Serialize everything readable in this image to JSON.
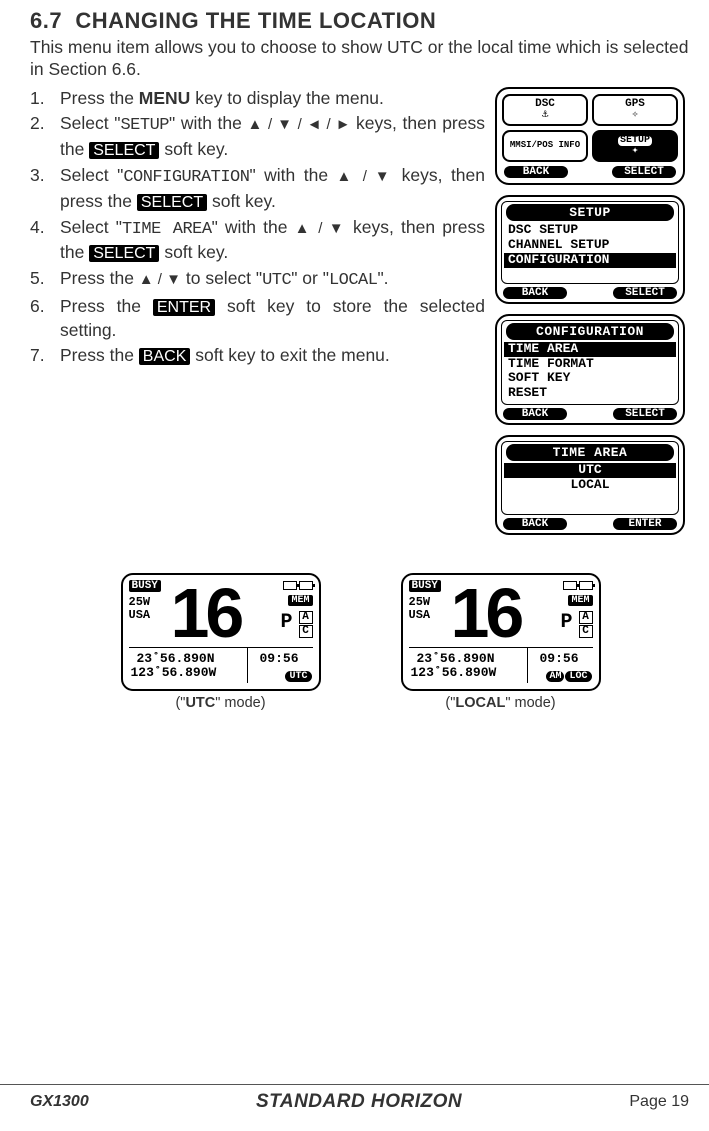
{
  "header": {
    "section_number": "6.7",
    "section_title": "CHANGING THE TIME LOCATION",
    "intro": "This menu item allows you to choose to show UTC or the local time which is selected in Section 6.6."
  },
  "steps": {
    "s1_a": "Press the ",
    "s1_key": "MENU",
    "s1_b": " key to display the menu.",
    "s2_a": "Select \"",
    "s2_m": "SETUP",
    "s2_b": "\" with the ",
    "s2_arrows": "▲ / ▼ / ◄ / ►",
    "s2_c": " keys, then press the ",
    "s2_sk": "SELECT",
    "s2_d": " soft key.",
    "s3_a": "Select \"",
    "s3_m": "CONFIGURATION",
    "s3_b": "\" with the ",
    "s3_arrows": "▲ / ▼",
    "s3_c": " keys, then press the ",
    "s3_sk": "SELECT",
    "s3_d": " soft key.",
    "s4_a": "Select \"",
    "s4_m": "TIME AREA",
    "s4_b": "\" with the ",
    "s4_arrows": "▲ / ▼",
    "s4_c": " keys, then press the ",
    "s4_sk": "SELECT",
    "s4_d": " soft key.",
    "s5_a": "Press the ",
    "s5_arrows": "▲ / ▼",
    "s5_b": " to select \"",
    "s5_m1": "UTC",
    "s5_c": "\" or \"",
    "s5_m2": "LOCAL",
    "s5_d": "\".",
    "s6_a": "Press the ",
    "s6_sk": "ENTER",
    "s6_b": " soft key to store the selected setting.",
    "s7_a": "Press the ",
    "s7_sk": "BACK",
    "s7_b": " soft key to exit the menu."
  },
  "lcd_top": {
    "dsc": "DSC",
    "gps": "GPS",
    "mmsi": "MMSI/POS INFO",
    "setup": "SETUP",
    "back": "BACK",
    "select": "SELECT"
  },
  "lcd_setup": {
    "title": "SETUP",
    "i1": "DSC SETUP",
    "i2": "CHANNEL SETUP",
    "i3": "CONFIGURATION",
    "back": "BACK",
    "select": "SELECT"
  },
  "lcd_config": {
    "title": "CONFIGURATION",
    "i1": "TIME AREA",
    "i2": "TIME FORMAT",
    "i3": "SOFT KEY",
    "i4": "RESET",
    "back": "BACK",
    "select": "SELECT"
  },
  "lcd_timearea": {
    "title": "TIME AREA",
    "i1": "UTC",
    "i2": "LOCAL",
    "back": "BACK",
    "enter": "ENTER"
  },
  "radio": {
    "busy": "BUSY",
    "pwr": "25W",
    "usa": "USA",
    "ch": "16",
    "mem": "MEM",
    "p": "P",
    "a": "A",
    "c": "C",
    "lat": "23˚56.890N",
    "lon": "123˚56.890W",
    "time": "09:56",
    "utc_tag": "UTC",
    "am": "AM",
    "loc": "LOC"
  },
  "captions": {
    "utc_a": "(\"",
    "utc_b": "UTC",
    "utc_c": "\" mode)",
    "local_a": "(\"",
    "local_b": "LOCAL",
    "local_c": "\" mode)"
  },
  "footer": {
    "model": "GX1300",
    "brand": "STANDARD HORIZON",
    "page": "Page 19"
  }
}
